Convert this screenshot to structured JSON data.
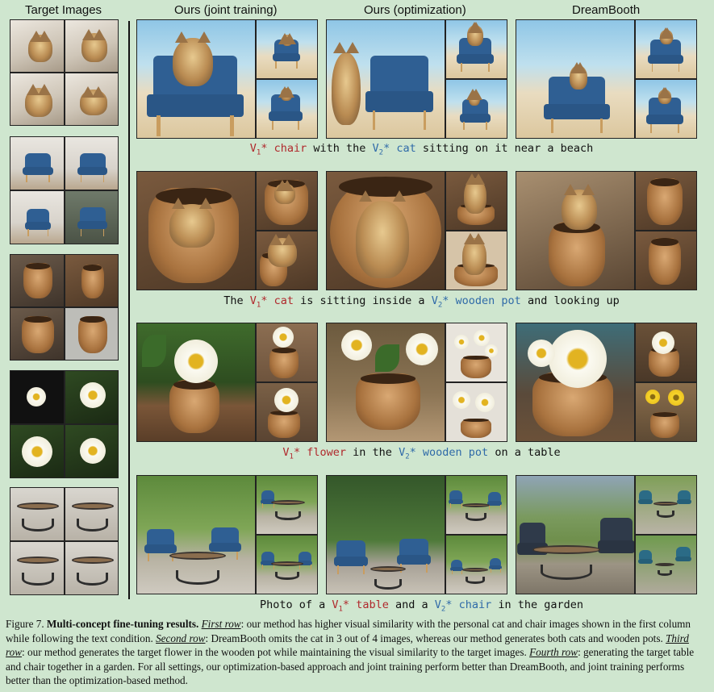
{
  "headers": {
    "target": "Target Images",
    "joint": "Ours (joint training)",
    "optim": "Ours (optimization)",
    "dreambooth": "DreamBooth"
  },
  "captions": {
    "row1": {
      "a": "V",
      "a_sub": "1",
      "a_star": "*",
      "a_word": "chair",
      "mid": " with the ",
      "b": "V",
      "b_sub": "2",
      "b_star": "*",
      "b_word": "cat",
      "end": " sitting on it near a beach"
    },
    "row2": {
      "pre": "The ",
      "a": "V",
      "a_sub": "1",
      "a_star": "*",
      "a_word": "cat",
      "mid": " is sitting inside a ",
      "b": "V",
      "b_sub": "2",
      "b_star": "*",
      "b_word": "wooden pot",
      "end": " and looking up"
    },
    "row3": {
      "a": "V",
      "a_sub": "1",
      "a_star": "*",
      "a_word": "flower",
      "mid": " in the ",
      "b": "V",
      "b_sub": "2",
      "b_star": "*",
      "b_word": "wooden pot",
      "end": " on a table"
    },
    "row4": {
      "pre": "Photo of a ",
      "a": "V",
      "a_sub": "1",
      "a_star": "*",
      "a_word": "table",
      "mid": " and a ",
      "b": "V",
      "b_sub": "2",
      "b_star": "*",
      "b_word": "chair",
      "end": " in the garden"
    }
  },
  "figure_caption": {
    "label": "Figure 7.",
    "title": "Multi-concept fine-tuning results.",
    "r1_label": "First row",
    "r1_text": ": our method has higher visual similarity with the personal cat and chair images shown in the first column while following the text condition. ",
    "r2_label": "Second row",
    "r2_text": ": DreamBooth omits the cat in 3 out of 4 images, whereas our method generates both cats and wooden pots. ",
    "r3_label": "Third row",
    "r3_text": ": our method generates the target flower in the wooden pot while maintaining the visual similarity to the target images. ",
    "r4_label": "Fourth row",
    "r4_text": ": generating the target table and chair together in a garden. For all settings, our optimization-based approach and joint training perform better than DreamBooth, and joint training performs better than the optimization-based method."
  },
  "colors": {
    "background": "#cfe6cf",
    "concept_v1": "#b0282c",
    "concept_v2": "#2f6aa8"
  }
}
